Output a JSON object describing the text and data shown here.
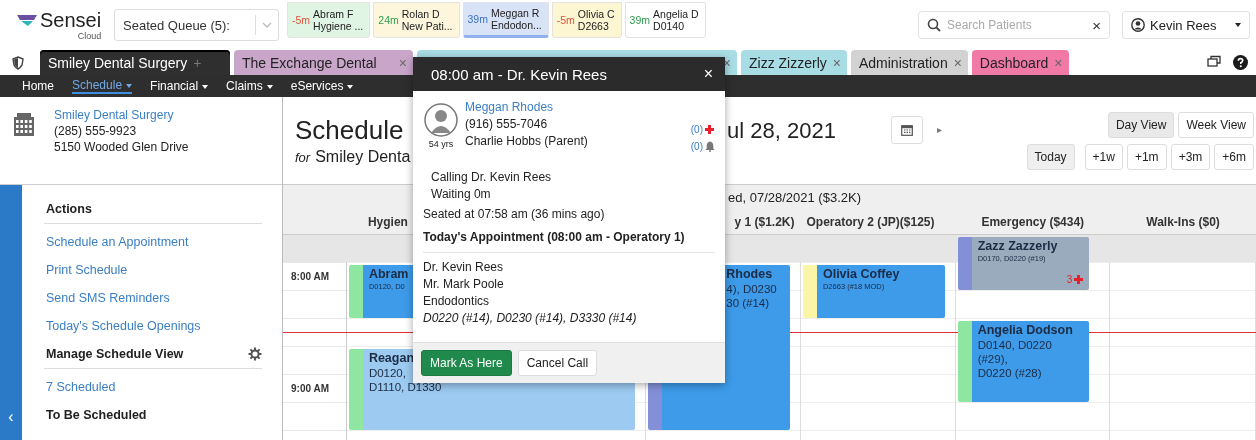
{
  "brand": {
    "name": "Sensei",
    "sub": "Cloud"
  },
  "seated_queue": {
    "label": "Seated Queue (5):"
  },
  "queue": [
    {
      "time": "-5m",
      "kind": "overdue",
      "name": "Abram F",
      "detail": "Hygiene ...",
      "color": "#e0f5e4",
      "selected": false
    },
    {
      "time": "24m",
      "kind": "ontime",
      "name": "Rolan D",
      "detail": "New Pati...",
      "color": "#fdf6dc",
      "selected": false
    },
    {
      "time": "39m",
      "kind": "called",
      "name": "Meggan R",
      "detail": "Endodon...",
      "color": "#d9e3f8",
      "selected": true
    },
    {
      "time": "-5m",
      "kind": "overdue",
      "name": "Olivia C",
      "detail": "D2663",
      "color": "#fdf6d2",
      "selected": false
    },
    {
      "time": "39m",
      "kind": "ontime",
      "name": "Angelia D",
      "detail": "D0140",
      "color": "#ffffff",
      "selected": false
    }
  ],
  "search": {
    "placeholder": "Search Patients",
    "clear": "×"
  },
  "user": {
    "name": "Kevin Rees"
  },
  "tabs": [
    {
      "label": "Smiley Dental Surgery",
      "close": "+",
      "color": "#2f2f2f",
      "selected": true
    },
    {
      "label": "The Exchange Dental",
      "close": "×",
      "color": "#c9a6c9",
      "selected": false
    },
    {
      "close": "×",
      "color": "#a9dde6",
      "selected": false
    },
    {
      "label": "Zizz Zizzerly",
      "close": "×",
      "color": "#a9dde6",
      "selected": false
    },
    {
      "label": "Administration",
      "close": "×",
      "color": "#d2d2d2",
      "selected": false
    },
    {
      "label": "Dashboard",
      "close": "×",
      "color": "#f07aa5",
      "selected": false
    }
  ],
  "nav": [
    {
      "label": "Home",
      "selected": false,
      "dropdown": false
    },
    {
      "label": "Schedule",
      "selected": true,
      "dropdown": true
    },
    {
      "label": "Financial",
      "selected": false,
      "dropdown": true
    },
    {
      "label": "Claims",
      "selected": false,
      "dropdown": true
    },
    {
      "label": "eServices",
      "selected": false,
      "dropdown": true
    }
  ],
  "office": {
    "name": "Smiley Dental Surgery",
    "phone": "(285) 555-9923",
    "address": "5150 Wooded Glen Drive"
  },
  "sidebar": {
    "items": [
      {
        "kind": "heading",
        "text": "Actions"
      },
      {
        "kind": "link",
        "text": "Schedule an Appointment"
      },
      {
        "kind": "link",
        "text": "Print Schedule"
      },
      {
        "kind": "link",
        "text": "Send SMS Reminders"
      },
      {
        "kind": "link",
        "text": "Today's Schedule Openings"
      },
      {
        "kind": "heading-settings",
        "text": "Manage Schedule View"
      },
      {
        "kind": "link",
        "text": "7 Scheduled"
      },
      {
        "kind": "heading",
        "text": "To Be Scheduled"
      }
    ],
    "collapse": "‹"
  },
  "schedule": {
    "title": "Schedule",
    "for_label": "for",
    "for_office": "Smiley Denta",
    "date": "ul 28, 2021",
    "next": "▸",
    "views": [
      {
        "label": "Day View",
        "selected": true
      },
      {
        "label": "Week View",
        "selected": false
      }
    ],
    "jumps": [
      "Today",
      "+1w",
      "+1m",
      "+3m",
      "+6m"
    ]
  },
  "grid": {
    "day": "ed, 07/28/2021 ($3.2K)",
    "times": [
      "8:00 AM",
      "9:00 AM"
    ],
    "columns": [
      {
        "header": "Hygien",
        "appointments": [
          {
            "color": "#8ee6a0",
            "name": "Abram",
            "codes": "D0120, D0",
            "kind": "booked"
          },
          {
            "color": "#8ee6a0",
            "name": "Reagan",
            "codes": "D0120,",
            "codes2": "D1110, D1330",
            "kind": "pending"
          }
        ]
      },
      {
        "header": "y 1 ($1.2K)",
        "appointments": [
          {
            "color": "#8390d8",
            "name": "Rhodes",
            "codes": "4), D0230",
            "codes2": "30 (#14)",
            "kind": "booked"
          }
        ]
      },
      {
        "header": "Operatory 2 (JP)($125)",
        "appointments": [
          {
            "color": "#fbf5a8",
            "name": "Olivia Coffey",
            "codes": "D2663 (#18 MOD)",
            "kind": "booked"
          }
        ]
      },
      {
        "header": "Emergency ($434)",
        "appointments": [
          {
            "color": "#8390d8",
            "name": "Zazz Zazzerly",
            "codes": "D0170, D0220 (#19)",
            "kind": "completed",
            "alerts": "3"
          },
          {
            "color": "#8ee6a0",
            "name": "Angelia Dodson",
            "codes": "D0140, D0220 (#29),",
            "codes2": "D0220 (#28)",
            "kind": "booked"
          }
        ]
      },
      {
        "header": "Walk-Ins ($0)"
      }
    ]
  },
  "popup": {
    "title": "08:00 am - Dr. Kevin Rees",
    "close": "×",
    "patient": {
      "name": "Meggan Rhodes",
      "phone": "(916) 555-7046",
      "age": "54 yrs",
      "guardian": "Charlie Hobbs (Parent)",
      "medical_alerts": "(0)",
      "notes": "(0)"
    },
    "status": [
      "Calling Dr. Kevin Rees",
      "Waiting 0m"
    ],
    "seated": "Seated at 07:58 am (36 mins ago)",
    "appointment_title": "Today's Appointment (08:00 am - Operatory 1)",
    "appointment": [
      "Dr. Kevin Rees",
      "Mr. Mark Poole",
      "Endodontics"
    ],
    "procedures": "D0220 (#14), D0230 (#14), D3330 (#14)",
    "buttons": [
      {
        "label": "Mark As Here",
        "kind": "primary"
      },
      {
        "label": "Cancel Call",
        "kind": "secondary"
      }
    ]
  }
}
